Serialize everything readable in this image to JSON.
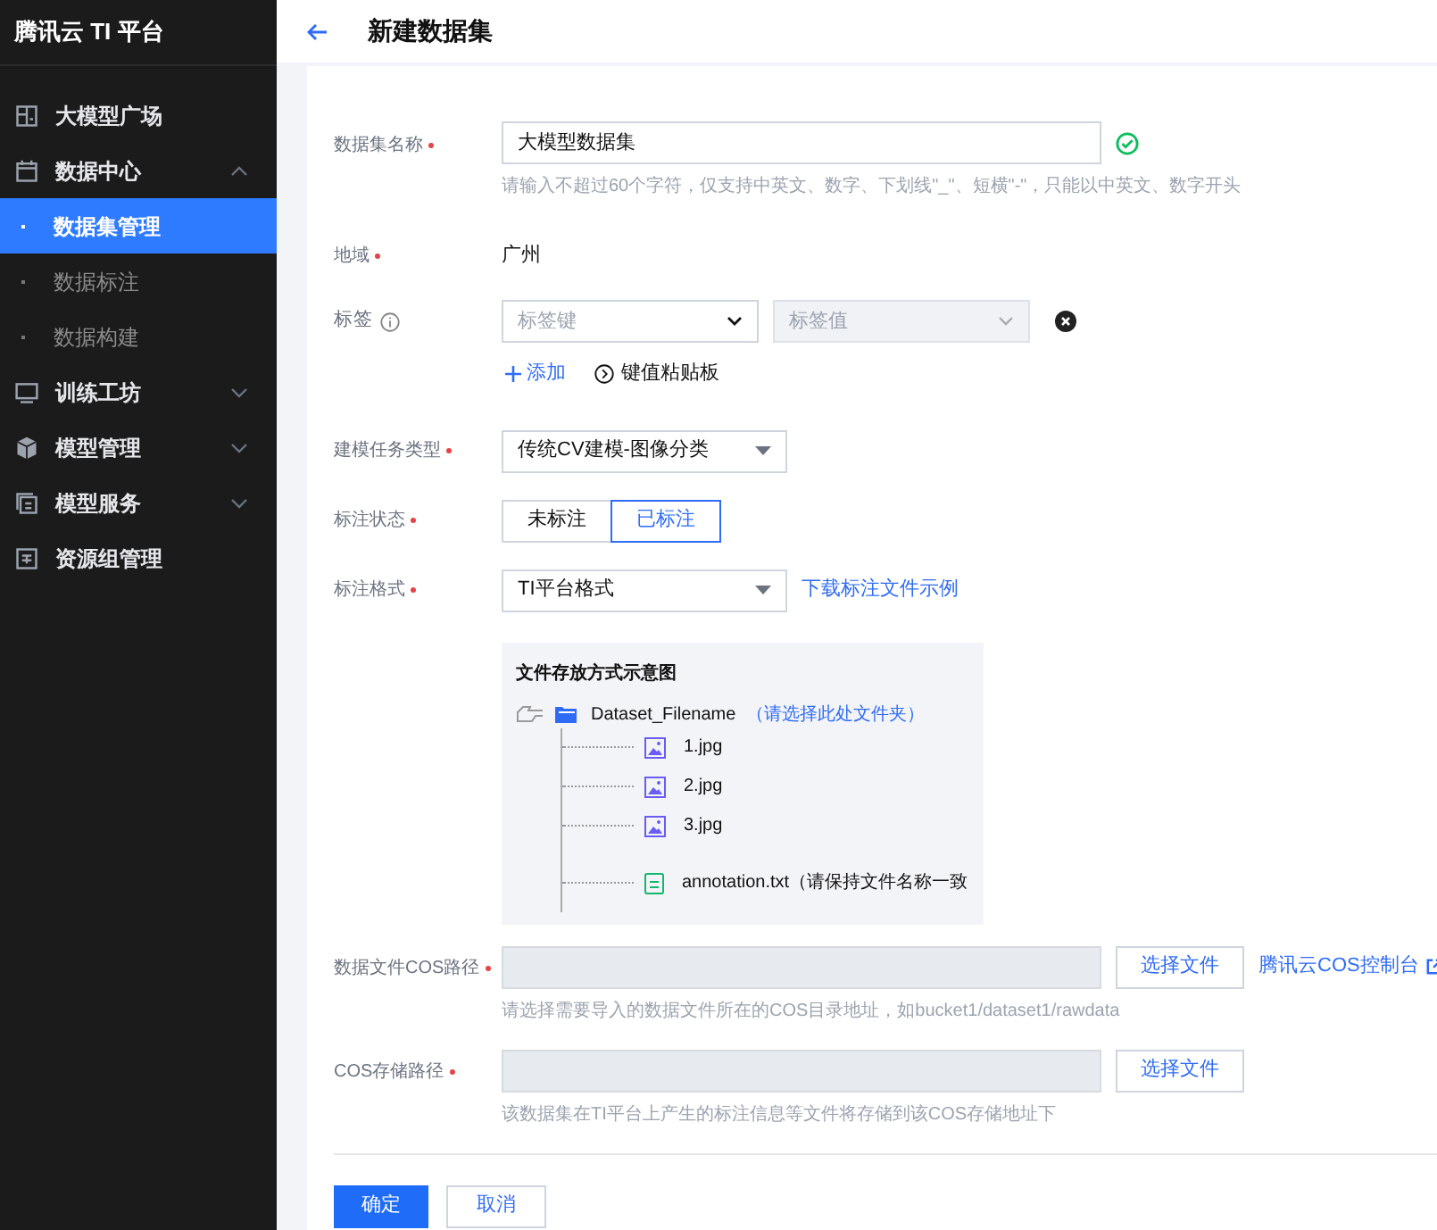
{
  "sidebar": {
    "title": "腾讯云 TI 平台",
    "items": [
      {
        "label": "大模型广场"
      },
      {
        "label": "数据中心",
        "expanded": true,
        "children": [
          {
            "label": "数据集管理",
            "selected": true
          },
          {
            "label": "数据标注",
            "selected": false
          },
          {
            "label": "数据构建",
            "selected": false
          }
        ]
      },
      {
        "label": "训练工坊",
        "expanded": false
      },
      {
        "label": "模型管理",
        "expanded": false
      },
      {
        "label": "模型服务",
        "expanded": false
      },
      {
        "label": "资源组管理"
      }
    ]
  },
  "header": {
    "title": "新建数据集"
  },
  "form": {
    "name": {
      "label": "数据集名称",
      "required": true,
      "value": "大模型数据集",
      "valid": true,
      "hint": "请输入不超过60个字符，仅支持中英文、数字、下划线\"_\"、短横\"-\"，只能以中英文、数字开头"
    },
    "region": {
      "label": "地域",
      "required": true,
      "value": "广州"
    },
    "tags": {
      "label": "标签",
      "required": false,
      "key_placeholder": "标签键",
      "value_placeholder": "标签值",
      "value_disabled": true,
      "add_label": "添加",
      "paste_label": "键值粘贴板"
    },
    "task_type": {
      "label": "建模任务类型",
      "required": true,
      "value": "传统CV建模-图像分类"
    },
    "annotation_status": {
      "label": "标注状态",
      "required": true,
      "options": [
        {
          "label": "未标注",
          "selected": false
        },
        {
          "label": "已标注",
          "selected": true
        }
      ]
    },
    "annotation_format": {
      "label": "标注格式",
      "required": true,
      "value": "TI平台格式",
      "link": "下载标注文件示例"
    },
    "diagram": {
      "title": "文件存放方式示意图",
      "folder": "Dataset_Filename",
      "folder_note": "（请选择此处文件夹）",
      "files": [
        {
          "kind": "image",
          "name": "1.jpg"
        },
        {
          "kind": "image",
          "name": "2.jpg"
        },
        {
          "kind": "image",
          "name": "3.jpg"
        },
        {
          "kind": "text",
          "name": "annotation.txt（请保持文件名称一致"
        }
      ]
    },
    "cos_path": {
      "label": "数据文件COS路径",
      "required": true,
      "button": "选择文件",
      "link": "腾讯云COS控制台",
      "hint": "请选择需要导入的数据文件所在的COS目录地址，如bucket1/dataset1/rawdata"
    },
    "cos_storage": {
      "label": "COS存储路径",
      "required": true,
      "button": "选择文件",
      "hint": "该数据集在TI平台上产生的标注信息等文件将存储到该COS存储地址下"
    }
  },
  "buttons": [
    {
      "label": "确定",
      "kind": "primary"
    },
    {
      "label": "取消",
      "kind": "secondary"
    }
  ]
}
